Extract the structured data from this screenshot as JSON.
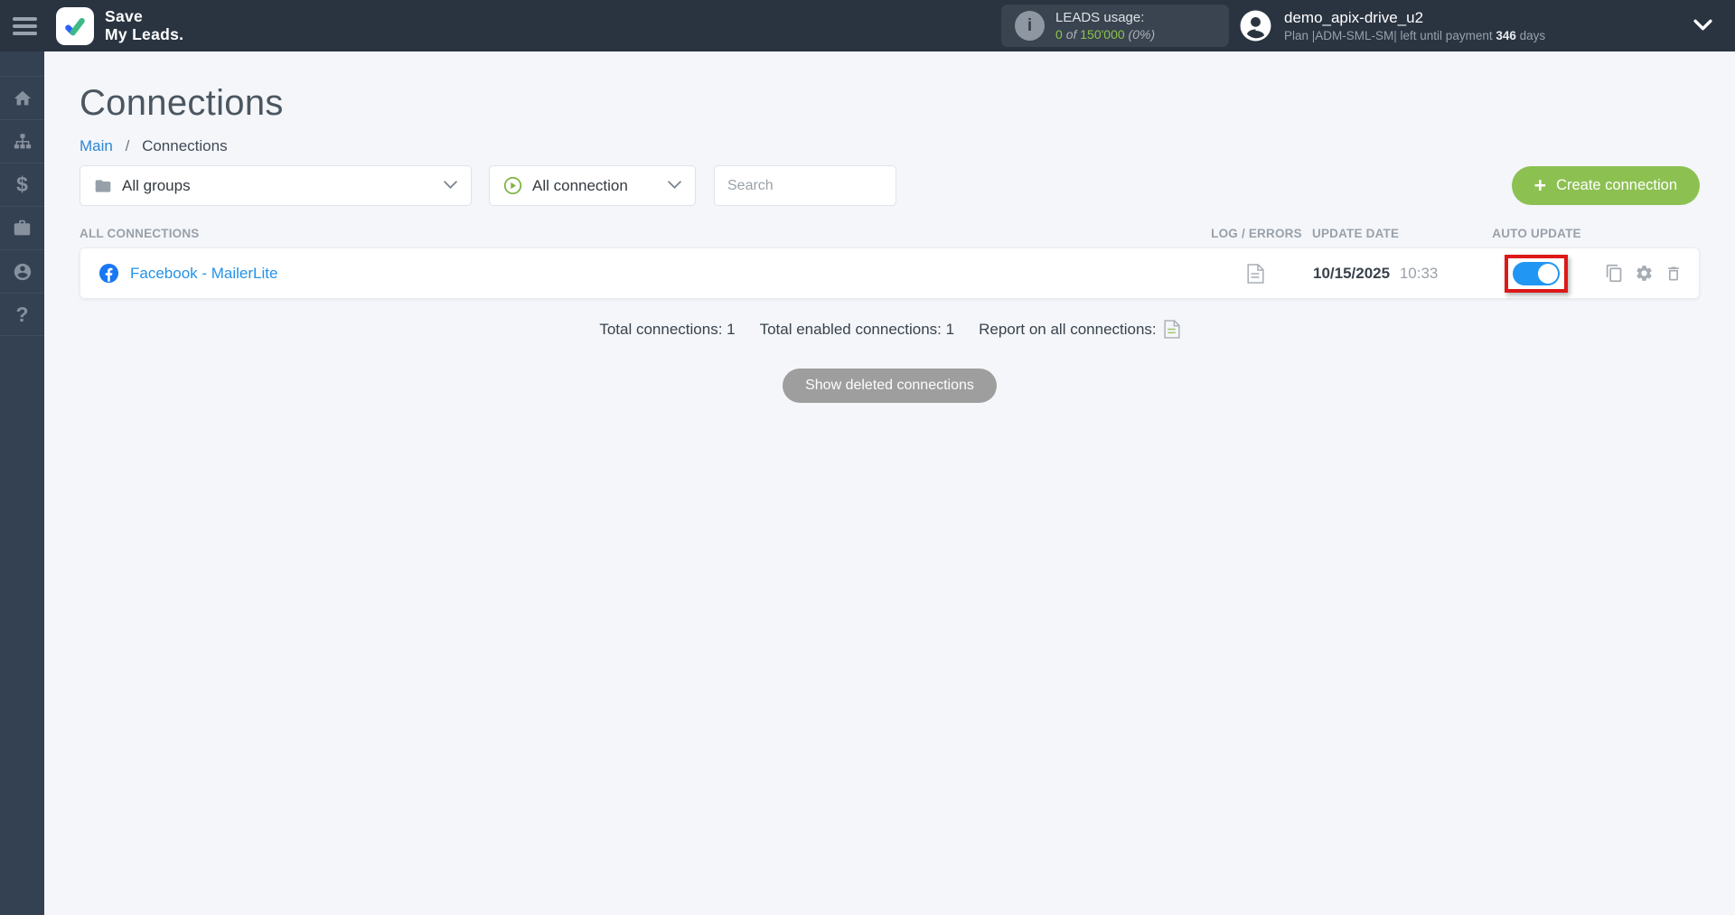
{
  "colors": {
    "header_bg": "#2a3441",
    "sidebar_bg": "#344153",
    "page_bg": "#f4f6fa",
    "accent_green": "#8cc152",
    "usage_green": "#8bc34a",
    "link_blue": "#2492e8",
    "toggle_blue": "#2196f3",
    "highlight_red": "#dd1818",
    "facebook_blue": "#1877f2"
  },
  "header": {
    "brand_line1": "Save",
    "brand_line2": "My Leads.",
    "leads_usage": {
      "label": "LEADS usage:",
      "used": "0",
      "of_word": "of",
      "total": "150'000",
      "percent": "(0%)"
    },
    "user": {
      "name": "demo_apix-drive_u2",
      "plan_prefix": "Plan |ADM-SML-SM| left until payment",
      "days": "346",
      "days_word": "days"
    }
  },
  "sidebar": {
    "dollar_glyph": "$",
    "help_glyph": "?"
  },
  "page": {
    "title": "Connections",
    "breadcrumb_main": "Main",
    "breadcrumb_sep": "/",
    "breadcrumb_current": "Connections"
  },
  "filters": {
    "groups_value": "All groups",
    "connection_value": "All connection",
    "search_placeholder": "Search",
    "create_label": "Create connection",
    "plus_glyph": "+"
  },
  "table": {
    "col_all": "ALL CONNECTIONS",
    "col_log": "LOG / ERRORS",
    "col_date": "UPDATE DATE",
    "col_auto": "AUTO UPDATE",
    "rows": [
      {
        "name": "Facebook - MailerLite",
        "date": "10/15/2025",
        "time": "10:33",
        "auto_update": "on"
      }
    ]
  },
  "summary": {
    "total": "Total connections: 1",
    "enabled": "Total enabled connections: 1",
    "report_label": "Report on all connections:"
  },
  "actions": {
    "show_deleted": "Show deleted connections"
  }
}
